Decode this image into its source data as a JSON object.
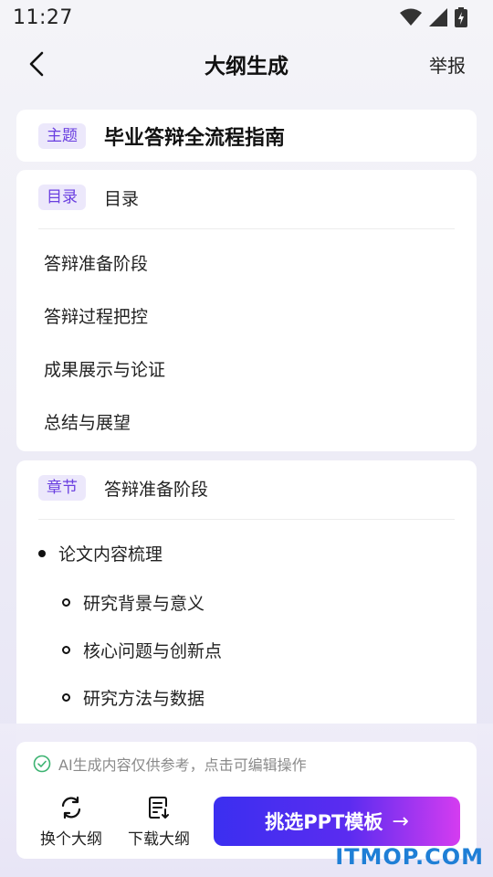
{
  "status_bar": {
    "time": "11:27"
  },
  "nav": {
    "title": "大纲生成",
    "report_label": "举报"
  },
  "topic": {
    "tag": "主题",
    "title": "毕业答辩全流程指南"
  },
  "toc": {
    "tag": "目录",
    "heading": "目录",
    "items": [
      "答辩准备阶段",
      "答辩过程把控",
      "成果展示与论证",
      "总结与展望"
    ]
  },
  "chapter": {
    "tag": "章节",
    "heading": "答辩准备阶段",
    "bullet": "论文内容梳理",
    "sub_items": [
      "研究背景与意义",
      "核心问题与创新点",
      "研究方法与数据"
    ]
  },
  "bottom": {
    "ai_note": "AI生成内容仅供参考，点击可编辑操作",
    "swap_label": "换个大纲",
    "download_label": "下载大纲",
    "cta_label": "挑选PPT模板",
    "cta_arrow": "→"
  },
  "watermark": "ITMOP.COM",
  "colors": {
    "accent": "#6a3fe0",
    "tag_bg": "#ece8fb",
    "cta_start": "#3b2ff0",
    "cta_end": "#d53cf0"
  }
}
